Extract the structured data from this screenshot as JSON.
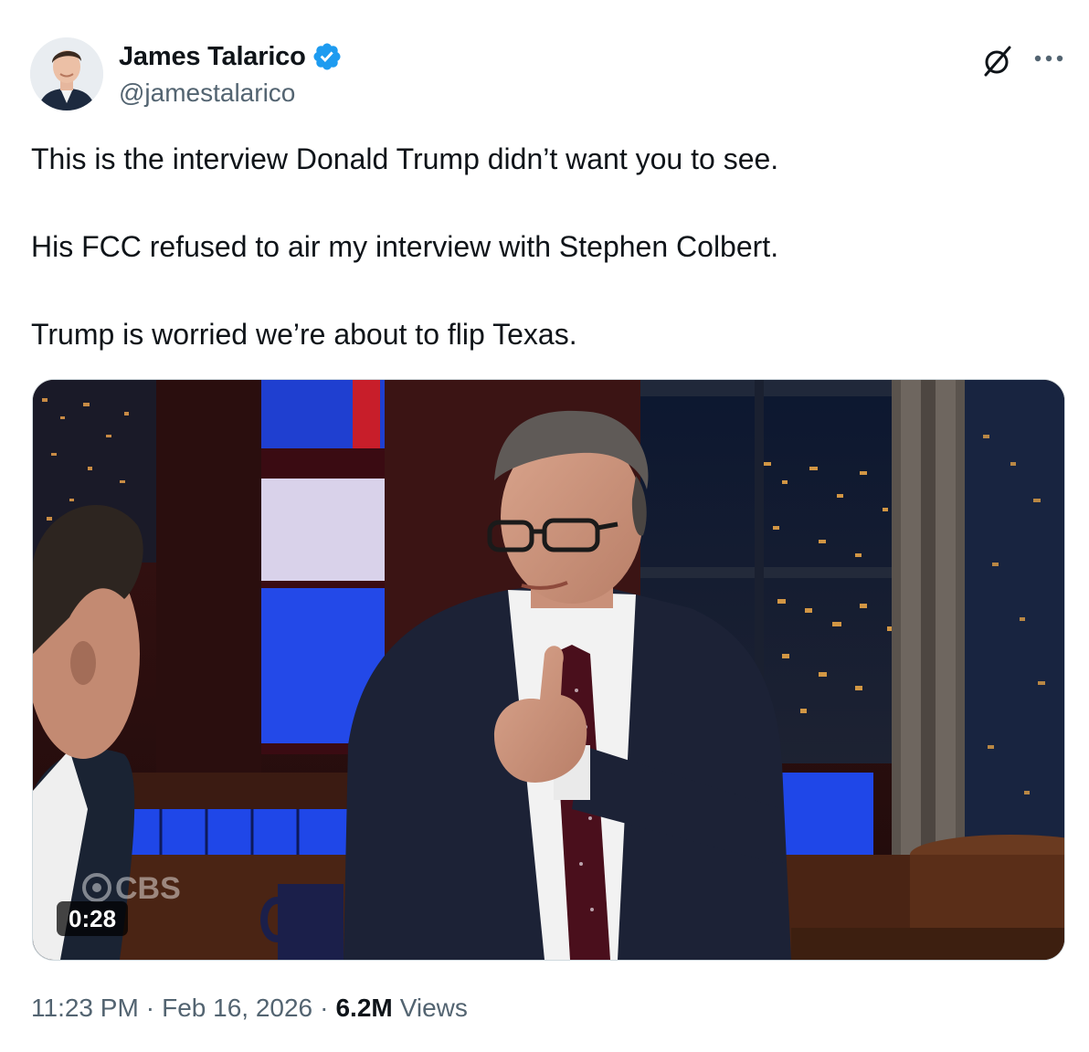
{
  "author": {
    "display_name": "James Talarico",
    "handle": "@jamestalarico",
    "verified": true,
    "avatar_icon": "profile-photo"
  },
  "actions": {
    "grok_icon": "grok-icon",
    "more_icon": "more-options-icon"
  },
  "tweet": {
    "paragraphs": [
      "This is the interview Donald Trump didn’t want you to see.",
      "His FCC refused to air my interview with Stephen Colbert.",
      "Trump is worried we’re about to flip Texas."
    ]
  },
  "media": {
    "type": "video",
    "duration": "0:28",
    "watermark": "CBS"
  },
  "meta": {
    "time": "11:23 PM",
    "separator": "·",
    "date": "Feb 16, 2026",
    "views_count": "6.2M",
    "views_label": "Views"
  },
  "colors": {
    "text_primary": "#0f1419",
    "text_secondary": "#536471",
    "verified_blue": "#1d9bf0",
    "border": "#cfd9de"
  }
}
